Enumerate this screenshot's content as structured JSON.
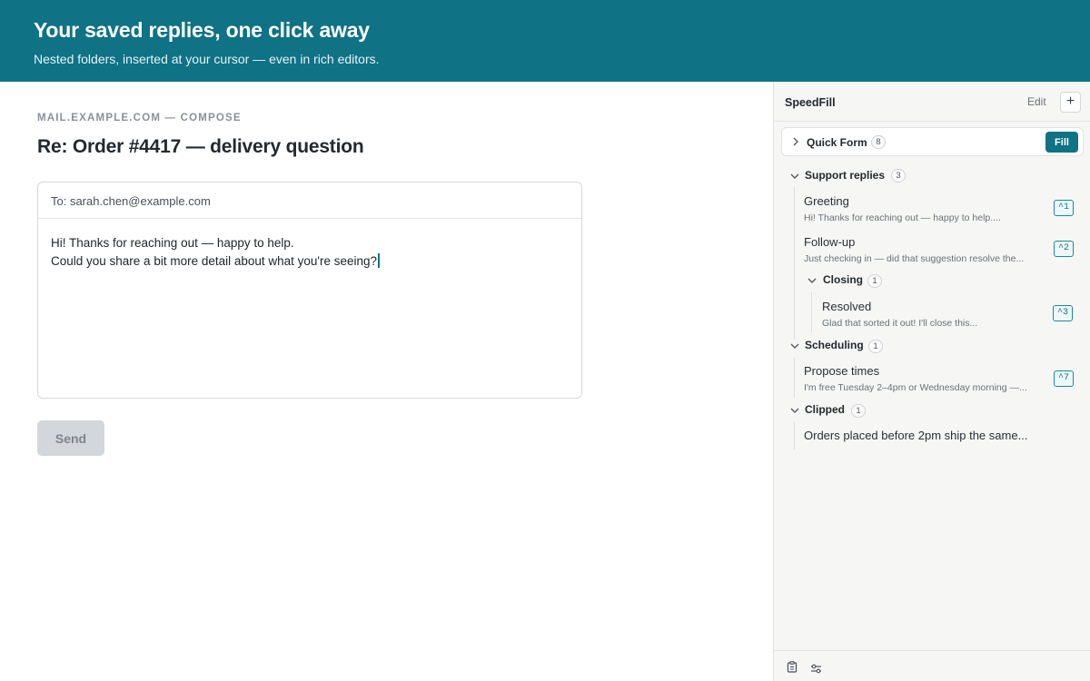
{
  "banner": {
    "title": "Your saved replies, one click away",
    "subtitle": "Nested folders, inserted at your cursor — even in rich editors."
  },
  "compose": {
    "eyebrow": "MAIL.EXAMPLE.COM — COMPOSE",
    "subject": "Re: Order #4417 — delivery question",
    "to": "To: sarah.chen@example.com",
    "body_line1": "Hi! Thanks for reaching out — happy to help.",
    "body_line2": "Could you share a bit more detail about what you're seeing?",
    "send_label": "Send"
  },
  "sidebar": {
    "title": "SpeedFill",
    "edit_label": "Edit",
    "add_label": "+",
    "quick_form": {
      "label": "Quick Form",
      "count": "8",
      "fill_label": "Fill"
    },
    "folders": {
      "support": {
        "label": "Support replies",
        "count": "3"
      },
      "closing": {
        "label": "Closing",
        "count": "1"
      },
      "scheduling": {
        "label": "Scheduling",
        "count": "1"
      },
      "clipped": {
        "label": "Clipped",
        "count": "1"
      }
    },
    "snippets": {
      "greeting": {
        "title": "Greeting",
        "preview": "Hi! Thanks for reaching out — happy to help....",
        "shortcut": "^1"
      },
      "followup": {
        "title": "Follow-up",
        "preview": "Just checking in — did that suggestion resolve the...",
        "shortcut": "^2"
      },
      "resolved": {
        "title": "Resolved",
        "preview": "Glad that sorted it out! I'll close this...",
        "shortcut": "^3"
      },
      "propose": {
        "title": "Propose times",
        "preview": "I'm free Tuesday 2–4pm or Wednesday morning —...",
        "shortcut": "^7"
      },
      "orders": {
        "title": "Orders placed before 2pm ship the same..."
      }
    },
    "icons": {
      "footer_left": "clipboard-icon",
      "footer_right": "sliders-icon"
    }
  },
  "colors": {
    "brand": "#0f7285",
    "sidebar_bg": "#f6f6f5",
    "send_disabled": "#d3d6da"
  }
}
